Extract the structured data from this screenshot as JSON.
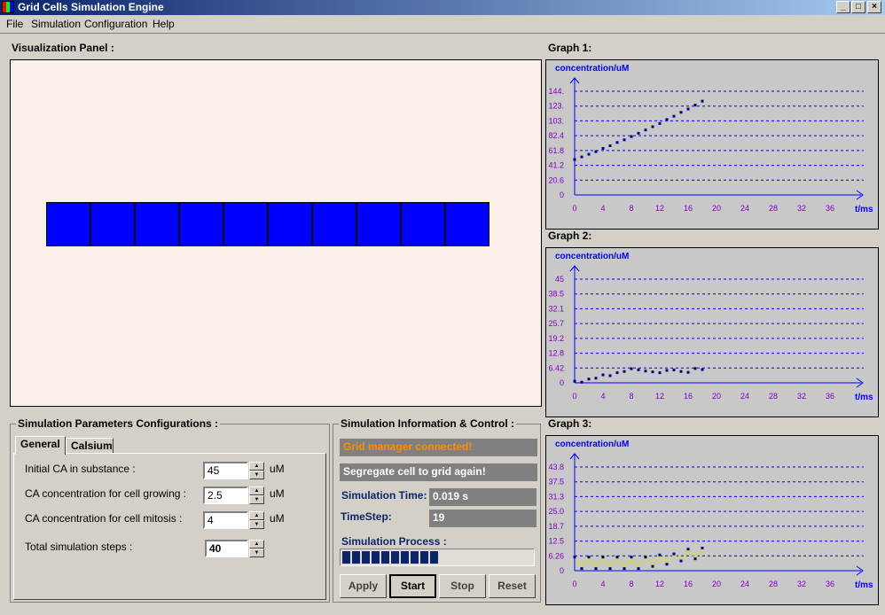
{
  "window": {
    "title": "Grid Cells Simulation Engine"
  },
  "menu": {
    "items": [
      "File",
      "Simulation",
      "Configuration",
      "Help"
    ]
  },
  "visualization": {
    "label": "Visualization Panel :",
    "cell_count": 10,
    "cell_color": "#0000ff",
    "bg_color": "#f9f0e7"
  },
  "graphs": [
    {
      "label": "Graph  1:",
      "ylabel": "concentration/uM",
      "xlabel": "t/ms",
      "yticks": [
        "144.",
        "123.",
        "103.",
        "82.4",
        "61.8",
        "41.2",
        "20.6",
        "0"
      ],
      "xticks": [
        "0",
        "4",
        "8",
        "12",
        "16",
        "20",
        "24",
        "28",
        "32",
        "36"
      ],
      "chart_data": {
        "type": "scatter",
        "xlim": [
          0,
          40
        ],
        "ylim": [
          0,
          164.8
        ],
        "series": [
          {
            "values": [
              [
                0,
                54
              ],
              [
                1,
                58
              ],
              [
                2,
                62
              ],
              [
                3,
                66
              ],
              [
                4,
                71
              ],
              [
                5,
                75
              ],
              [
                6,
                80
              ],
              [
                7,
                84
              ],
              [
                8,
                89
              ],
              [
                9,
                94
              ],
              [
                10,
                99
              ],
              [
                11,
                104
              ],
              [
                12,
                109
              ],
              [
                13,
                115
              ],
              [
                14,
                120
              ],
              [
                15,
                126
              ],
              [
                16,
                131
              ],
              [
                17,
                137
              ],
              [
                18,
                143
              ]
            ]
          }
        ]
      }
    },
    {
      "label": "Graph 2:",
      "ylabel": "concentration/uM",
      "xlabel": "t/ms",
      "yticks": [
        "45",
        "38.5",
        "32.1",
        "25.7",
        "19.2",
        "12.8",
        "6.42",
        "0"
      ],
      "xticks": [
        "0",
        "4",
        "8",
        "12",
        "16",
        "20",
        "24",
        "28",
        "32",
        "36"
      ],
      "chart_data": {
        "type": "scatter",
        "xlim": [
          0,
          40
        ],
        "ylim": [
          0,
          51.4
        ],
        "series": [
          {
            "values": [
              [
                0,
                0.8
              ],
              [
                1,
                0.3
              ],
              [
                2,
                1.8
              ],
              [
                3,
                2.2
              ],
              [
                4,
                3.8
              ],
              [
                5,
                3.4
              ],
              [
                6,
                4.8
              ],
              [
                7,
                5.4
              ],
              [
                8,
                6.7
              ],
              [
                9,
                6.2
              ],
              [
                10,
                5.6
              ],
              [
                11,
                5.2
              ],
              [
                12,
                4.8
              ],
              [
                13,
                5.9
              ],
              [
                14,
                6.1
              ],
              [
                15,
                5.4
              ],
              [
                16,
                5.0
              ],
              [
                17,
                6.8
              ],
              [
                18,
                6.3
              ]
            ]
          }
        ]
      }
    },
    {
      "label": "Graph 3:",
      "ylabel": "concentration/uM",
      "xlabel": "t/ms",
      "yticks": [
        "43.8",
        "37.5",
        "31.3",
        "25.0",
        "18.7",
        "12.5",
        "6.26",
        "0"
      ],
      "xticks": [
        "0",
        "4",
        "8",
        "12",
        "16",
        "20",
        "24",
        "28",
        "32",
        "36"
      ],
      "chart_data": {
        "type": "scatter",
        "xlim": [
          0,
          40
        ],
        "ylim": [
          0,
          50.1
        ],
        "series": [
          {
            "values": [
              [
                0,
                6.3
              ],
              [
                1,
                1.0
              ],
              [
                2,
                6.3
              ],
              [
                3,
                1.0
              ],
              [
                4,
                6.3
              ],
              [
                5,
                1.0
              ],
              [
                6,
                6.3
              ],
              [
                7,
                1.0
              ],
              [
                8,
                6.3
              ],
              [
                9,
                1.0
              ],
              [
                10,
                6.3
              ],
              [
                11,
                2.0
              ],
              [
                12,
                7.3
              ],
              [
                13,
                3.0
              ],
              [
                14,
                7.8
              ],
              [
                15,
                4.5
              ],
              [
                16,
                10.0
              ],
              [
                17,
                5.5
              ],
              [
                18,
                10.5
              ]
            ]
          }
        ]
      }
    }
  ],
  "params": {
    "title": "Simulation Parameters Configurations :",
    "tabs": [
      "General",
      "Calsium"
    ],
    "rows": [
      {
        "label": "Initial CA in substance :",
        "value": "45",
        "unit": "uM"
      },
      {
        "label": "CA concentration for cell growing :",
        "value": "2.5",
        "unit": "uM"
      },
      {
        "label": "CA concentration for cell mitosis :",
        "value": "4",
        "unit": "uM"
      },
      {
        "label": "Total simulation steps :",
        "value": "40",
        "unit": ""
      }
    ]
  },
  "control": {
    "title": "Simulation Information & Control :",
    "status1": "Grid manager connected!",
    "status2": "Segregate cell to grid again!",
    "sim_time_label": "Simulation Time:",
    "sim_time_value": "0.019 s",
    "timestep_label": "TimeStep:",
    "timestep_value": "19",
    "process_label": "Simulation Process :",
    "progress_fraction": 0.475,
    "buttons": [
      "Apply",
      "Start",
      "Stop",
      "Reset"
    ]
  },
  "colors": {
    "status1_text": "#ff8c00",
    "grid_line": "#0000ff",
    "axis": "#0000ff",
    "tick_label": "#8000c0",
    "series": "#00008b",
    "graph3_line": "#e0e000"
  }
}
